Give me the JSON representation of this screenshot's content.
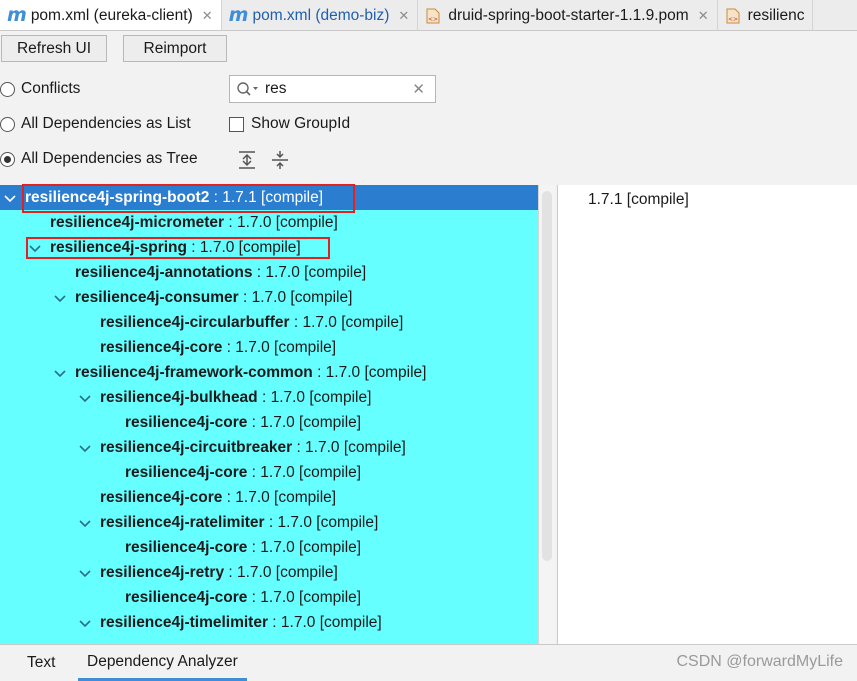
{
  "tabs": [
    {
      "icon": "maven-m-icon",
      "glyph": "m",
      "label": "pom.xml (eureka-client)",
      "active": true
    },
    {
      "icon": "maven-m-icon",
      "glyph": "m",
      "label": "pom.xml (demo-biz)",
      "active": false
    },
    {
      "icon": "xml-file-icon",
      "label": "druid-spring-boot-starter-1.1.9.pom",
      "active": false
    },
    {
      "icon": "xml-file-icon",
      "label": "resilienc",
      "active": false
    }
  ],
  "toolbar": {
    "refresh_label": "Refresh UI",
    "reimport_label": "Reimport"
  },
  "options": {
    "conflicts_label": "Conflicts",
    "list_label": "All Dependencies as List",
    "tree_label": "All Dependencies as Tree",
    "show_groupid_label": "Show GroupId",
    "selected_mode": "tree",
    "show_groupid_checked": false
  },
  "search": {
    "value": "res",
    "clear_glyph": "✕"
  },
  "tree": {
    "rows": [
      {
        "level": 0,
        "expanded": true,
        "selected": true,
        "name": "resilience4j-spring-boot2",
        "version": " : 1.7.1 [compile]"
      },
      {
        "level": 1,
        "expanded": null,
        "name": "resilience4j-micrometer",
        "version": " : 1.7.0 [compile]"
      },
      {
        "level": 1,
        "expanded": true,
        "name": "resilience4j-spring",
        "version": " : 1.7.0 [compile]"
      },
      {
        "level": 2,
        "expanded": null,
        "name": "resilience4j-annotations",
        "version": " : 1.7.0 [compile]"
      },
      {
        "level": 2,
        "expanded": true,
        "name": "resilience4j-consumer",
        "version": " : 1.7.0 [compile]"
      },
      {
        "level": 3,
        "expanded": null,
        "name": "resilience4j-circularbuffer",
        "version": " : 1.7.0 [compile]"
      },
      {
        "level": 3,
        "expanded": null,
        "name": "resilience4j-core",
        "version": " : 1.7.0 [compile]"
      },
      {
        "level": 2,
        "expanded": true,
        "name": "resilience4j-framework-common",
        "version": " : 1.7.0 [compile]"
      },
      {
        "level": 3,
        "expanded": true,
        "name": "resilience4j-bulkhead",
        "version": " : 1.7.0 [compile]"
      },
      {
        "level": 4,
        "expanded": null,
        "name": "resilience4j-core",
        "version": " : 1.7.0 [compile]"
      },
      {
        "level": 3,
        "expanded": true,
        "name": "resilience4j-circuitbreaker",
        "version": " : 1.7.0 [compile]"
      },
      {
        "level": 4,
        "expanded": null,
        "name": "resilience4j-core",
        "version": " : 1.7.0 [compile]"
      },
      {
        "level": 3,
        "expanded": null,
        "name": "resilience4j-core",
        "version": " : 1.7.0 [compile]"
      },
      {
        "level": 3,
        "expanded": true,
        "name": "resilience4j-ratelimiter",
        "version": " : 1.7.0 [compile]"
      },
      {
        "level": 4,
        "expanded": null,
        "name": "resilience4j-core",
        "version": " : 1.7.0 [compile]"
      },
      {
        "level": 3,
        "expanded": true,
        "name": "resilience4j-retry",
        "version": " : 1.7.0 [compile]"
      },
      {
        "level": 4,
        "expanded": null,
        "name": "resilience4j-core",
        "version": " : 1.7.0 [compile]"
      },
      {
        "level": 3,
        "expanded": true,
        "name": "resilience4j-timelimiter",
        "version": " : 1.7.0 [compile]"
      }
    ]
  },
  "detail": {
    "text": "1.7.1 [compile]"
  },
  "bottom_tabs": [
    {
      "label": "Text",
      "active": false
    },
    {
      "label": "Dependency Analyzer",
      "active": true
    }
  ],
  "watermark": "CSDN @forwardMyLife",
  "colors": {
    "tree_bg": "#66ffff",
    "selection": "#2b7dd0",
    "highlight_box": "#e22222",
    "maven_blue": "#3f8ed6"
  }
}
